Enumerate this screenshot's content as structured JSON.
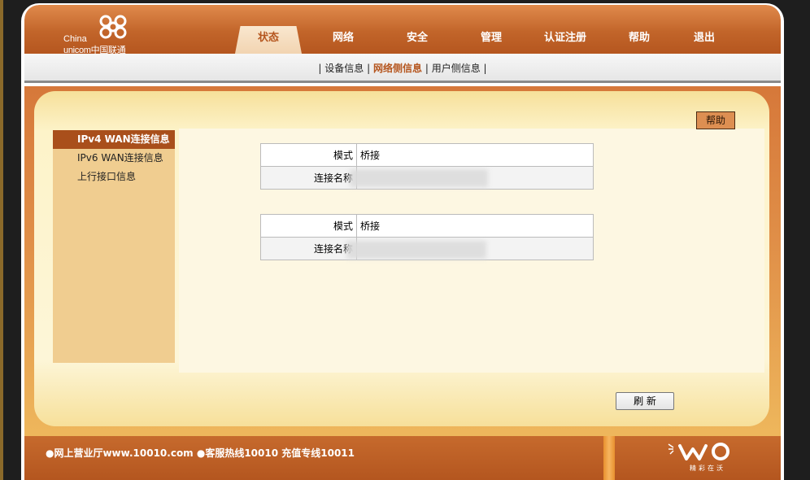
{
  "brand": {
    "logo_line1": "China",
    "logo_line2": "unicom中国联通"
  },
  "nav": {
    "tabs": [
      {
        "label": "状态"
      },
      {
        "label": "网络"
      },
      {
        "label": "安全"
      },
      {
        "label": "管理"
      },
      {
        "label": "认证注册"
      },
      {
        "label": "帮助"
      },
      {
        "label": "退出"
      }
    ],
    "active": "状态"
  },
  "subnav": {
    "items": [
      "设备信息",
      "网络侧信息",
      "用户侧信息"
    ],
    "active": "网络侧信息",
    "separator": "|"
  },
  "sidebar": {
    "items": [
      {
        "label": "IPv4 WAN连接信息"
      },
      {
        "label": "IPv6 WAN连接信息"
      },
      {
        "label": "上行接口信息"
      }
    ],
    "active": "IPv4 WAN连接信息"
  },
  "help_button": "帮助",
  "connections": [
    {
      "mode_label": "模式",
      "mode_value": "桥接",
      "name_label": "连接名称",
      "name_value": ""
    },
    {
      "mode_label": "模式",
      "mode_value": "桥接",
      "name_label": "连接名称",
      "name_value": ""
    }
  ],
  "refresh_button": "刷 新",
  "footer": {
    "text": "●网上营业厅www.10010.com ●客服热线10010 充值专线10011",
    "wo_tagline": "精彩在沃"
  },
  "colors": {
    "header": "#c2652a",
    "accent": "#a94f1b",
    "sidebar": "#f0cd90",
    "panel": "#fdf6d8"
  }
}
